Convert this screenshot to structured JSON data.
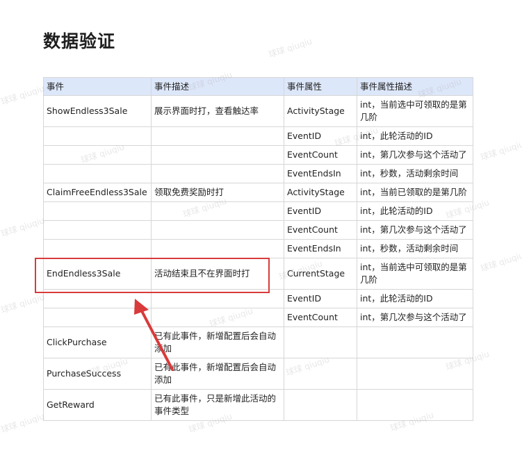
{
  "title": "数据验证",
  "table": {
    "headers": [
      "事件",
      "事件描述",
      "事件属性",
      "事件属性描述"
    ],
    "rows": [
      {
        "event": "ShowEndless3Sale",
        "desc": "展示界面时打，查看触达率",
        "prop": "ActivityStage",
        "prop_desc": "int，当前选中可领取的是第几阶"
      },
      {
        "event": "",
        "desc": "",
        "prop": "EventID",
        "prop_desc": "int，此轮活动的ID"
      },
      {
        "event": "",
        "desc": "",
        "prop": "EventCount",
        "prop_desc": "int，第几次参与这个活动了"
      },
      {
        "event": "",
        "desc": "",
        "prop": "EventEndsIn",
        "prop_desc": "int，秒数，活动剩余时间"
      },
      {
        "event": "ClaimFreeEndless3Sale",
        "desc": "领取免费奖励时打",
        "prop": "ActivityStage",
        "prop_desc": "int，当前已领取的是第几阶"
      },
      {
        "event": "",
        "desc": "",
        "prop": "EventID",
        "prop_desc": "int，此轮活动的ID"
      },
      {
        "event": "",
        "desc": "",
        "prop": "EventCount",
        "prop_desc": "int，第几次参与这个活动了"
      },
      {
        "event": "",
        "desc": "",
        "prop": "EventEndsIn",
        "prop_desc": "int，秒数，活动剩余时间"
      },
      {
        "event": "EndEndless3Sale",
        "desc": "活动结束且不在界面时打",
        "prop": "CurrentStage",
        "prop_desc": "int，当前选中可领取的是第几阶"
      },
      {
        "event": "",
        "desc": "",
        "prop": "EventID",
        "prop_desc": "int，此轮活动的ID"
      },
      {
        "event": "",
        "desc": "",
        "prop": "EventCount",
        "prop_desc": "int，第几次参与这个活动了"
      },
      {
        "event": "ClickPurchase",
        "desc": "已有此事件，新增配置后会自动添加",
        "prop": "",
        "prop_desc": ""
      },
      {
        "event": "PurchaseSuccess",
        "desc": "已有此事件，新增配置后会自动添加",
        "prop": "",
        "prop_desc": ""
      },
      {
        "event": "GetReward",
        "desc": "已有此事件，只是新增此活动的事件类型",
        "prop": "",
        "prop_desc": ""
      }
    ]
  },
  "watermark_text": "球球 qiuqiu",
  "colors": {
    "header_bg": "#dde7fa",
    "highlight": "#d93a3a"
  }
}
